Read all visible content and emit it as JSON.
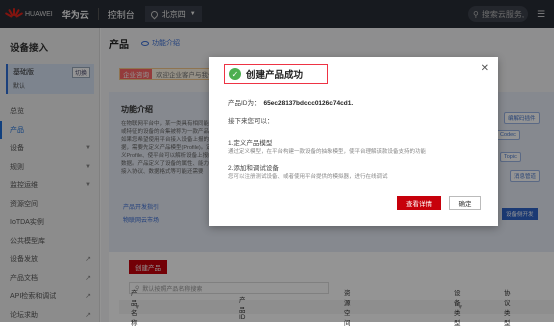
{
  "topbar": {
    "brand": "HUAWEI",
    "cloud_name": "华为云",
    "console": "控制台",
    "region": "北京四",
    "search_placeholder": "搜索云服务,"
  },
  "sidebar": {
    "title": "设备接入",
    "version": {
      "name": "基础版",
      "upgrade": "切换",
      "default": "默认"
    },
    "items": [
      {
        "label": "总览"
      },
      {
        "label": "产品"
      },
      {
        "label": "设备"
      },
      {
        "label": "规则"
      },
      {
        "label": "监控运维"
      },
      {
        "label": "资源空间"
      },
      {
        "label": "IoTDA实例"
      },
      {
        "label": "公共模型库"
      },
      {
        "label": "设备发放"
      },
      {
        "label": "产品文档"
      },
      {
        "label": "API检索和调试"
      },
      {
        "label": "论坛求助"
      }
    ]
  },
  "main": {
    "title": "产品",
    "func_link": "功能介绍",
    "notice_tag": "企业咨询",
    "notice_text": "欢迎企业客户与我们",
    "intro_title": "功能介绍",
    "intro_text": "在物联网平台中，某一类具有相同能力或特征的设备的合集被称为一款产品。如果您希望使用平台接入设备上报的数据，需要先定义产品模型(Profile)。定义Profile、使平台可以解析设备上报的数据。产品定义了设备的属性、能力、接入协议、数据格式等可能还需要",
    "intro_links": [
      "产品开发指引",
      "物联网云市场"
    ],
    "diagram": {
      "top": "编解码插件",
      "codec": "Codec",
      "topic": "Topic",
      "msg": "消息管道",
      "dev": "设备侧开发"
    },
    "create_button": "创建产品",
    "search_placeholder": "默认按照产品名称搜索",
    "columns": [
      "产品名称",
      "产品ID",
      "资源空间",
      "设备类型",
      "协议类型"
    ]
  },
  "modal": {
    "title": "创建产品成功",
    "product_id_label": "产品ID为：",
    "product_id": "65ec28137bdccc0126c74cd1.",
    "next_label": "接下来您可以：",
    "step1_title": "1.定义产品模型",
    "step1_desc": "通过定义模型，在平台构建一款设备的抽象模型，使平台理解该款设备支持的功能",
    "step2_title": "2.添加和调试设备",
    "step2_desc": "您可以注册测试设备、或者使用平台提供的模拟器，进行在线调试",
    "detail_button": "查看详情",
    "ok_button": "确定"
  }
}
